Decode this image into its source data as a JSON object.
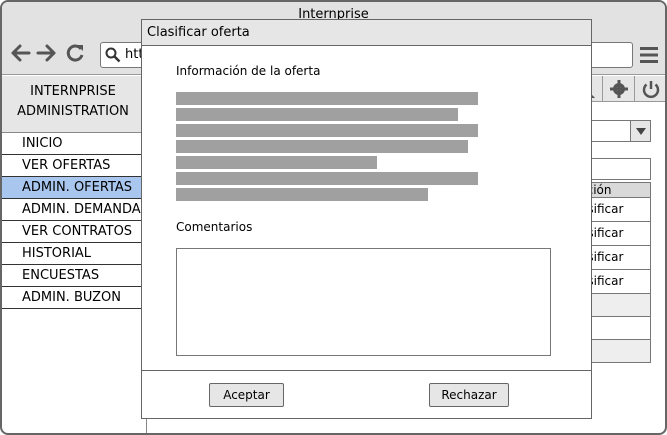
{
  "window": {
    "title": "Internprise"
  },
  "navbar": {
    "url_text": "htt",
    "icons": [
      "back-arrow-icon",
      "forward-arrow-icon",
      "reload-icon",
      "search-icon",
      "hamburger-menu-icon"
    ]
  },
  "sidebar": {
    "header_line1": "INTERNPRISE",
    "header_line2": "ADMINISTRATION",
    "items": [
      {
        "label": "INICIO"
      },
      {
        "label": "VER OFERTAS"
      },
      {
        "label": "ADMIN. OFERTAS",
        "selected": true
      },
      {
        "label": "ADMIN. DEMANDAS"
      },
      {
        "label": "VER CONTRATOS"
      },
      {
        "label": "HISTORIAL"
      },
      {
        "label": "ENCUESTAS"
      },
      {
        "label": "ADMIN. BUZON"
      }
    ]
  },
  "toolbar": {
    "icons": [
      "user-icon",
      "gear-icon",
      "power-icon"
    ]
  },
  "table": {
    "header": "cción",
    "rows": [
      "asificar",
      "asificar",
      "asificar",
      "asificar"
    ]
  },
  "modal": {
    "title": "Clasificar oferta",
    "info_label": "Información de la oferta",
    "comments_label": "Comentarios",
    "comments_value": "",
    "accept_label": "Aceptar",
    "reject_label": "Rechazar"
  },
  "colors": {
    "selected_menu": "#a9c7ee",
    "chrome_gray": "#e2e2e2",
    "placeholder_text": "#a0a0a0"
  }
}
